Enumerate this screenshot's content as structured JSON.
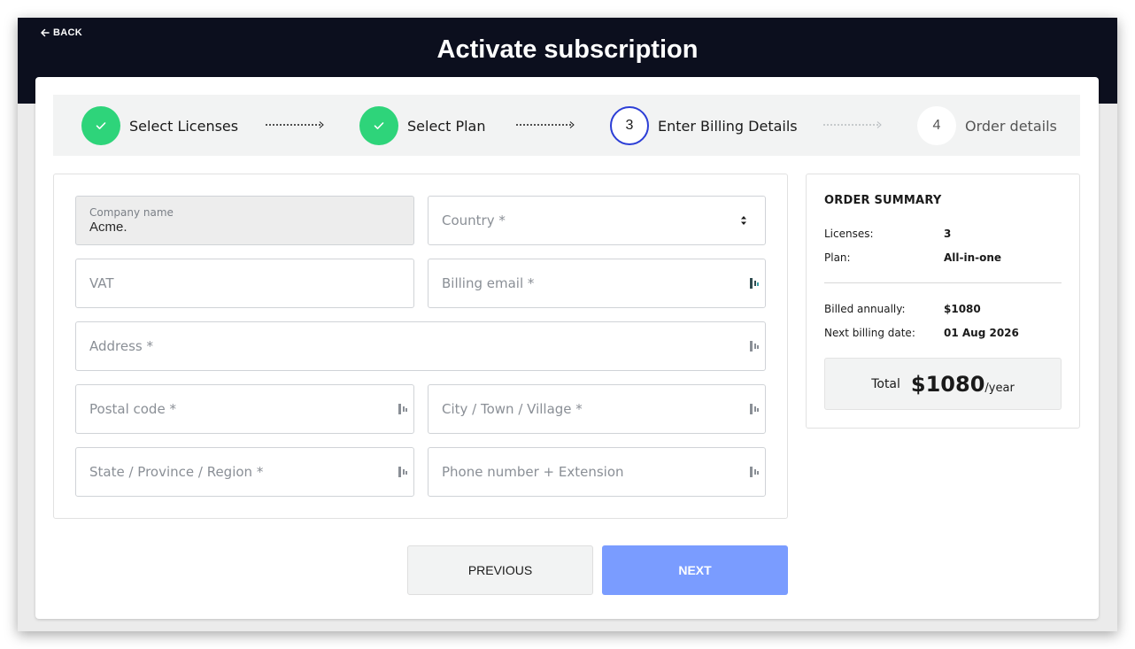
{
  "header": {
    "back_label": "BACK",
    "title": "Activate subscription"
  },
  "stepper": {
    "steps": [
      {
        "label": "Select Licenses",
        "status": "done"
      },
      {
        "label": "Select Plan",
        "status": "done"
      },
      {
        "number": "3",
        "label": "Enter Billing Details",
        "status": "current"
      },
      {
        "number": "4",
        "label": "Order details",
        "status": "todo"
      }
    ]
  },
  "form": {
    "company": {
      "label": "Company name",
      "value": "Acme."
    },
    "country": {
      "placeholder": "Country *"
    },
    "vat": {
      "placeholder": "VAT"
    },
    "billing_email": {
      "placeholder": "Billing email *"
    },
    "address": {
      "placeholder": "Address *"
    },
    "postal_code": {
      "placeholder": "Postal code *"
    },
    "city": {
      "placeholder": "City / Town / Village *"
    },
    "state": {
      "placeholder": "State / Province / Region *"
    },
    "phone": {
      "placeholder": "Phone number + Extension"
    }
  },
  "summary": {
    "heading": "ORDER SUMMARY",
    "licenses_label": "Licenses:",
    "licenses_value": "3",
    "plan_label": "Plan:",
    "plan_value": "All-in-one",
    "billed_label": "Billed annually:",
    "billed_value": "$1080",
    "next_label": "Next billing date:",
    "next_value": "01 Aug 2026",
    "total_label": "Total",
    "total_amount": "$1080",
    "total_period": "/year"
  },
  "buttons": {
    "previous": "PREVIOUS",
    "next": "NEXT"
  },
  "colors": {
    "header_bg": "#0c0f1e",
    "step_done": "#2ed47a",
    "step_current_ring": "#2c3ed6",
    "next_button": "#7a9cff"
  }
}
